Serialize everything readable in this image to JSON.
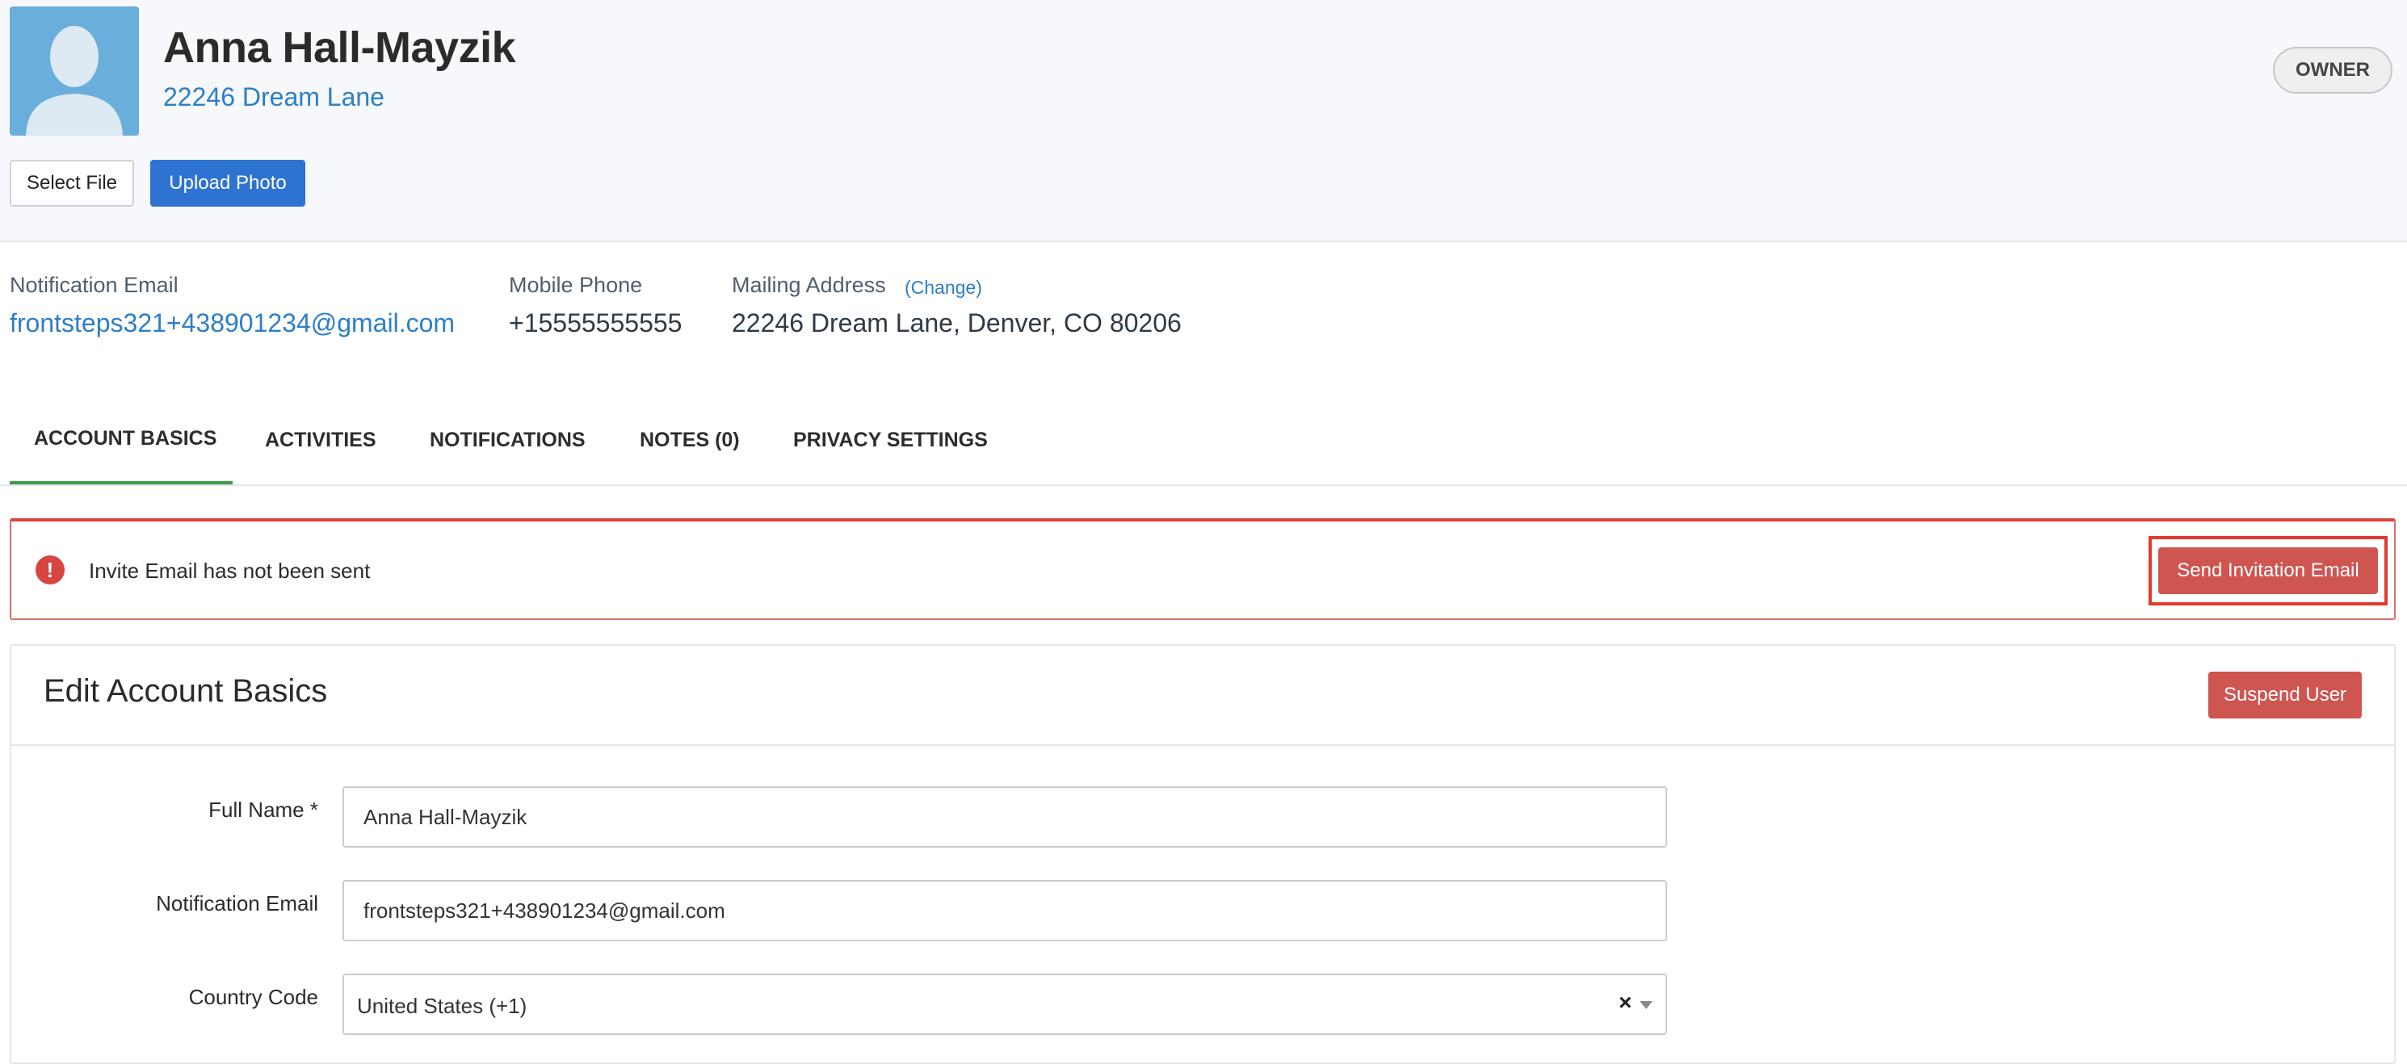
{
  "profile": {
    "name": "Anna Hall-Mayzik",
    "address_link": "22246 Dream Lane",
    "role_badge": "OWNER",
    "select_file_label": "Select File",
    "upload_photo_label": "Upload Photo"
  },
  "contact": {
    "email_label": "Notification Email",
    "email_value": "frontsteps321+438901234@gmail.com",
    "phone_label": "Mobile Phone",
    "phone_value": "+15555555555",
    "mailing_label": "Mailing Address",
    "mailing_change": "(Change)",
    "mailing_value": "22246 Dream Lane, Denver, CO 80206"
  },
  "tabs": [
    {
      "label": "ACCOUNT BASICS",
      "active": true
    },
    {
      "label": "ACTIVITIES",
      "active": false
    },
    {
      "label": "NOTIFICATIONS",
      "active": false
    },
    {
      "label": "NOTES (0)",
      "active": false
    },
    {
      "label": "PRIVACY SETTINGS",
      "active": false
    }
  ],
  "alert": {
    "icon": "exclamation-circle-icon",
    "message": "Invite Email has not been sent",
    "button_label": "Send Invitation Email"
  },
  "form": {
    "title": "Edit Account Basics",
    "suspend_label": "Suspend User",
    "full_name_label": "Full Name *",
    "full_name_value": "Anna Hall-Mayzik",
    "email_label": "Notification Email",
    "email_value": "frontsteps321+438901234@gmail.com",
    "country_code_label": "Country Code",
    "country_code_value": "United States (+1)",
    "clear_symbol": "×"
  },
  "colors": {
    "primary": "#2e73d1",
    "link": "#2e7ec7",
    "danger": "#cf5551",
    "active_tab": "#3f9a4a"
  }
}
